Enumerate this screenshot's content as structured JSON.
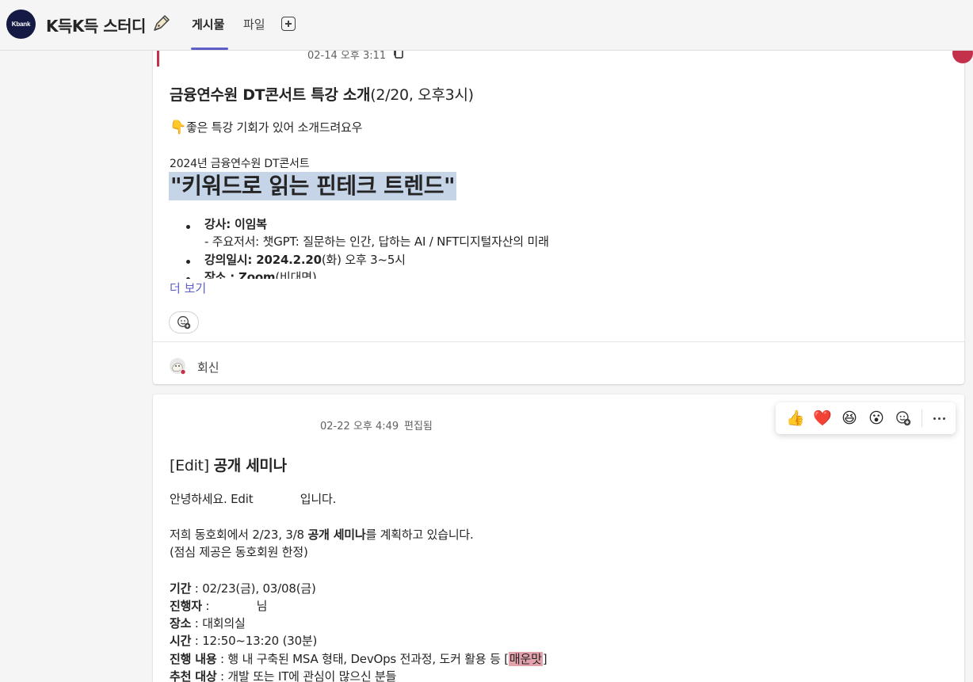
{
  "header": {
    "team_logo_text": "Kbank",
    "team_name": "K득K득 스터디",
    "tabs": [
      {
        "label": "게시물",
        "active": true
      },
      {
        "label": "파일",
        "active": false
      }
    ],
    "accent_color": "#5b5fc7"
  },
  "post1": {
    "timestamp": "02-14 오후 3:11",
    "title_main": "금융연수원 DT콘서트 특강 소개",
    "title_suffix": "(2/20, 오후3시)",
    "intro": "좋은 특강 기회가 있어 소개드려요우",
    "intro_icon": "point-down-emoji",
    "subtitle": "2024년 금융연수원 DT콘서트",
    "headline": "\"키워드로 읽는 핀테크 트렌드\"",
    "bullets": [
      {
        "label": "강사: ",
        "value": "이임복",
        "sub": "- 주요저서: 챗GPT: 질문하는 인간, 답하는 AI / NFT디지털자산의 미래"
      },
      {
        "label": "강의일시: ",
        "value": "2024.2.20",
        "suffix": "(화) 오후 3~5시"
      },
      {
        "label": "장소 : ",
        "value": "Zoom",
        "suffix": "(비대면)"
      }
    ],
    "see_more": "더 보기",
    "reply_label": "회신"
  },
  "post2": {
    "timestamp": "02-22 오후 4:49",
    "edited": "편집됨",
    "title_prefix": "[Edit] ",
    "title_main": "공개 세미나",
    "greeting": "안녕하세요. Edit             입니다.",
    "plan_pre": "저희 동호회에서 2/23, 3/8 ",
    "plan_bold": "공개 세미나",
    "plan_post": "를 계획하고 있습니다.",
    "note": "(점심 제공은 동호회원 한정)",
    "details": [
      {
        "label": "기간",
        "value": " : 02/23(금), 03/08(금)"
      },
      {
        "label": "진행자",
        "value": " :             님"
      },
      {
        "label": "장소",
        "value": " : 대회의실"
      },
      {
        "label": "시간",
        "value": " : 12:50~13:20 (30분)"
      },
      {
        "label": "진행 내용",
        "value": " : 행 내 구축된 MSA 형태, DevOps 전과정, 도커 활용 등 [",
        "highlight": "매운맛",
        "tail": "]"
      },
      {
        "label": "추천 대상",
        "value": " : 개발 또는 IT에 관심이 많으신 분들"
      }
    ]
  },
  "reactions": [
    {
      "name": "like",
      "glyph": "👍"
    },
    {
      "name": "heart",
      "glyph": "❤️"
    },
    {
      "name": "laugh",
      "glyph": "😆"
    },
    {
      "name": "surprised",
      "glyph": "😮"
    }
  ]
}
